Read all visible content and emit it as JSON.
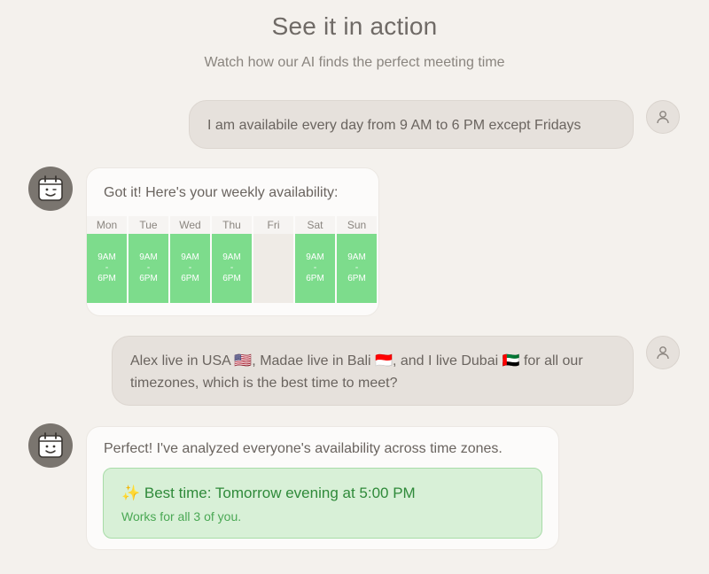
{
  "header": {
    "title": "See it in action",
    "subtitle": "Watch how our AI finds the perfect meeting time"
  },
  "messages": {
    "user1": {
      "text": "I am availabile every day from 9 AM to 6 PM except Fridays"
    },
    "bot1": {
      "text": "Got it! Here's your weekly availability:",
      "schedule": [
        {
          "day": "Mon",
          "available": true,
          "start": "9AM",
          "sep": "-",
          "end": "6PM"
        },
        {
          "day": "Tue",
          "available": true,
          "start": "9AM",
          "sep": "-",
          "end": "6PM"
        },
        {
          "day": "Wed",
          "available": true,
          "start": "9AM",
          "sep": "-",
          "end": "6PM"
        },
        {
          "day": "Thu",
          "available": true,
          "start": "9AM",
          "sep": "-",
          "end": "6PM"
        },
        {
          "day": "Fri",
          "available": false,
          "start": "",
          "sep": "",
          "end": ""
        },
        {
          "day": "Sat",
          "available": true,
          "start": "9AM",
          "sep": "-",
          "end": "6PM"
        },
        {
          "day": "Sun",
          "available": true,
          "start": "9AM",
          "sep": "-",
          "end": "6PM"
        }
      ]
    },
    "user2": {
      "line1": "Alex live in USA 🇺🇸, Madae live in Bali 🇮🇩, and I live Dubai 🇦🇪 for all our",
      "line2": "timezones, which is the best time to meet?"
    },
    "bot2": {
      "text": "Perfect! I've analyzed everyone's availability across time zones.",
      "best_title": "✨ Best time: Tomorrow evening at 5:00 PM",
      "best_sub": "Works for all 3 of you."
    }
  },
  "icons": {
    "user_avatar": "user-icon",
    "bot_avatar": "calendar-face-icon"
  },
  "colors": {
    "background": "#f4f1ed",
    "available": "#7ddc8c",
    "unavailable": "#efebe6",
    "best_box": "#d8f0d7",
    "best_text": "#2f8a3a"
  }
}
